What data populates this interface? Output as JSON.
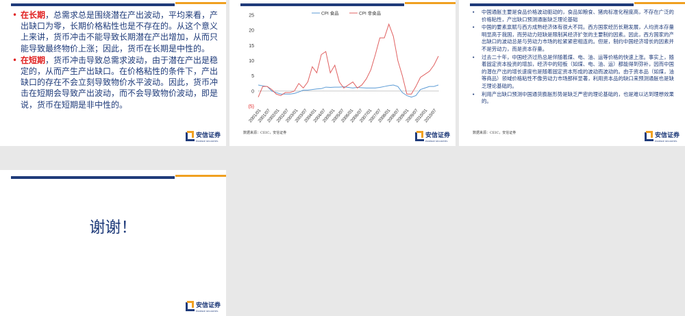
{
  "slides": [
    {
      "bullets": [
        {
          "highlight": "在长期",
          "text": "，总需求总是围绕潜在产出波动，平均来看，产出缺口为零，长期价格粘性也是不存在的。从这个意义上来讲，货币冲击不能导致长期潜在产出增加，从而只能导致最终物价上涨；因此，货币在长期是中性的。"
        },
        {
          "highlight": "在短期",
          "text": "，货币冲击导致总需求波动，由于潜在产出是稳定的，从而产生产出缺口。在价格粘性的条件下，产出缺口的存在不会立刻导致物价水平波动。因此，货币冲击在短期会导致产出波动，而不会导致物价波动，即是说，货币在短期是非中性的。"
        }
      ]
    },
    {
      "source": "数据来源：CEIC，安信证券"
    },
    {
      "bullets": [
        "中国通胀主要是食品价格波动驱动的，食品如粮食、猪肉标准化程度高，不存在广泛的价格粘性，产出缺口预测通胀缺乏理论基础",
        "中国的要素禀赋与西方成熟经济体有很大不同。西方国家经历长期发展，人均资本存量明显高于我国，而劳动力短缺是限制其经济扩张的主要制约因素。因此，西方国家的产出缺口的波动总是与劳动力市场的松紧紧密相连的。但是，制约中国经济增长的因素并不是劳动力，而是资本存量。",
        "过去二十年，中国经济过热总是伴随着煤、电、油、运等价格的快速上涨。事实上，随着固定资本投资的增加，经济中的短板（如煤、电、油、运）都能得到弥补，因而中国的潜在产出的增长速度也是随着固定资本形成的波动而波动的。由于资本品（如煤，油等商品）领域价格粘性不像劳动力市场那样显著，利用资本品的缺口来预测通胀也是缺乏理论基础的。",
        "利用产出缺口预测中国通货膨胀形势是缺乏严密的理论基础的，也是难以达到理想效果的。"
      ],
      "source": "数据来源：CEIC，安信证券"
    },
    {
      "title": "谢谢！"
    }
  ],
  "logo": {
    "name": "安信证券",
    "sub": "ESSENCE SECURITIES"
  },
  "chart_data": {
    "type": "line",
    "title": "",
    "legend_position": "top",
    "ylim": [
      -5,
      25
    ],
    "yticks": [
      "(5)",
      "0",
      "5",
      "10",
      "15",
      "20",
      "25"
    ],
    "ytick_values": [
      -5,
      0,
      5,
      10,
      15,
      20,
      25
    ],
    "xtick_labels": [
      "2001/01",
      "2001/07",
      "2002/01",
      "2002/07",
      "2003/01",
      "2003/07",
      "2004/01",
      "2004/07",
      "2005/01",
      "2005/07",
      "2006/01",
      "2006/07",
      "2007/01",
      "2007/07",
      "2008/01",
      "2008/07",
      "2009/01",
      "2009/07",
      "2010/01",
      "2010/07"
    ],
    "x_note": "quarterly points 2001/01 to 2010/12",
    "series": [
      {
        "name": "CPI 食品",
        "color": "#5b9bd5",
        "values": [
          2,
          1.7,
          1.5,
          0,
          -0.5,
          -1,
          -1,
          -1,
          -0.8,
          -0.3,
          0.3,
          0.3,
          0.5,
          0.7,
          0.8,
          1.3,
          1.2,
          1.3,
          1.3,
          1.4,
          1.2,
          1,
          1.2,
          1.1,
          1,
          1,
          1,
          1.2,
          1.5,
          1.8,
          2,
          1.5,
          -0.5,
          -1.5,
          -2,
          -1.5,
          0.5,
          1,
          1.5,
          1.5,
          2
        ]
      },
      {
        "name": "CPI 非食品",
        "color": "#e06060",
        "values": [
          -2,
          1.5,
          1.5,
          0.5,
          -1,
          -1.5,
          -0.5,
          -0.5,
          0,
          2.5,
          1,
          3,
          8,
          6,
          12,
          13,
          6,
          8.5,
          3,
          1,
          2,
          3,
          1,
          2,
          4,
          7,
          12,
          17.5,
          17.5,
          22,
          18,
          10,
          5,
          -1,
          -1,
          1.5,
          4.5,
          5.5,
          6.5,
          8.5,
          11.5
        ]
      }
    ]
  }
}
